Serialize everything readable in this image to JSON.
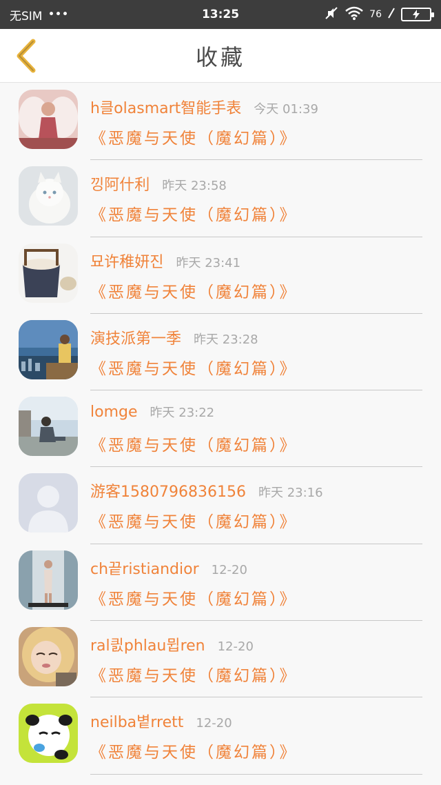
{
  "status_bar": {
    "carrier": "无SIM",
    "dots": "•••",
    "time": "13:25",
    "battery_text": "76"
  },
  "header": {
    "title": "收藏"
  },
  "favorites": [
    {
      "name": "h클olasmart智能手表",
      "time": "今天 01:39",
      "subject": "《恶魔与天使（魔幻篇）》",
      "avatar": "angel-avatar"
    },
    {
      "name": "낑阿什利",
      "time": "昨天 23:58",
      "subject": "《恶魔与天使（魔幻篇）》",
      "avatar": "white-cat-avatar"
    },
    {
      "name": "묘许稚妍진",
      "time": "昨天 23:41",
      "subject": "《恶魔与天使（魔幻篇）》",
      "avatar": "bucket-avatar"
    },
    {
      "name": "演技派第一季",
      "time": "昨天 23:28",
      "subject": "《恶魔与天使（魔幻篇）》",
      "avatar": "city-view-avatar"
    },
    {
      "name": "lomge",
      "time": "昨天 23:22",
      "subject": "《恶魔与天使（魔幻篇）》",
      "avatar": "sitting-man-avatar"
    },
    {
      "name": "游客1580796836156",
      "time": "昨天 23:16",
      "subject": "《恶魔与天使（魔幻篇）》",
      "avatar": "default-person-avatar"
    },
    {
      "name": "ch끝ristiandior",
      "time": "12-20",
      "subject": "《恶魔与天使（魔幻篇）》",
      "avatar": "standing-woman-avatar"
    },
    {
      "name": "ral킔phlau뮙ren",
      "time": "12-20",
      "subject": "《恶魔与天使（魔幻篇）》",
      "avatar": "blonde-woman-avatar"
    },
    {
      "name": "neilba볕rrett",
      "time": "12-20",
      "subject": "《恶魔与天使（魔幻篇）》",
      "avatar": "cartoon-panda-avatar"
    }
  ],
  "colors": {
    "accent": "#f0833a",
    "muted": "#a8a8a8",
    "back_arrow": "#e8b33c",
    "status_bar_bg": "#3d3d3d"
  }
}
